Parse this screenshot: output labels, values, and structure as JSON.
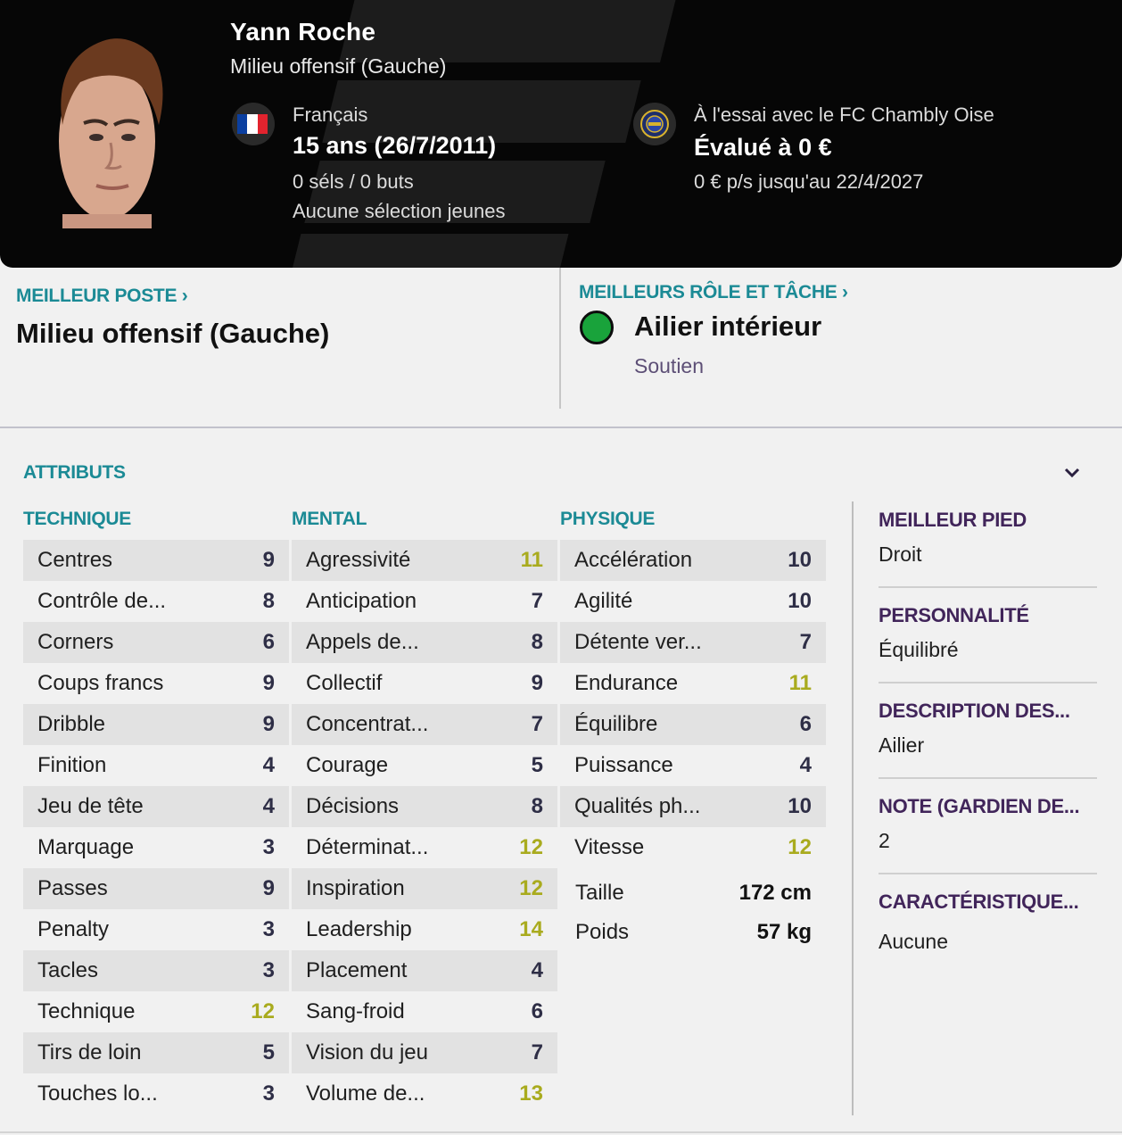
{
  "header": {
    "player_name": "Yann Roche",
    "position": "Milieu offensif (Gauche)",
    "nationality": "Français",
    "age_line": "15 ans (26/7/2011)",
    "caps_goals": "0 séls / 0 buts",
    "youth_caps": "Aucune sélection jeunes",
    "club_status": "À l'essai avec le FC Chambly Oise",
    "valuation": "Évalué à 0 €",
    "contract": "0 € p/s jusqu'au 22/4/2027",
    "flag_colors": [
      "#0b3fa0",
      "#ffffff",
      "#e3232e"
    ],
    "icons": [
      "player-face",
      "france-flag-icon",
      "club-crest-icon"
    ]
  },
  "best_position": {
    "link_label": "MEILLEUR POSTE",
    "value": "Milieu offensif (Gauche)"
  },
  "best_role": {
    "link_label": "MEILLEURS RÔLE ET TÂCHE",
    "role": "Ailier intérieur",
    "duty": "Soutien",
    "indicator_color": "#19a33b"
  },
  "attributes": {
    "title": "ATTRIBUTS",
    "technique": {
      "heading": "TECHNIQUE",
      "rows": [
        {
          "label": "Centres",
          "value": "9"
        },
        {
          "label": "Contrôle de...",
          "value": "8"
        },
        {
          "label": "Corners",
          "value": "6"
        },
        {
          "label": "Coups francs",
          "value": "9"
        },
        {
          "label": "Dribble",
          "value": "9"
        },
        {
          "label": "Finition",
          "value": "4"
        },
        {
          "label": "Jeu de tête",
          "value": "4"
        },
        {
          "label": "Marquage",
          "value": "3"
        },
        {
          "label": "Passes",
          "value": "9"
        },
        {
          "label": "Penalty",
          "value": "3"
        },
        {
          "label": "Tacles",
          "value": "3"
        },
        {
          "label": "Technique",
          "value": "12"
        },
        {
          "label": "Tirs de loin",
          "value": "5"
        },
        {
          "label": "Touches lo...",
          "value": "3"
        }
      ]
    },
    "mental": {
      "heading": "MENTAL",
      "rows": [
        {
          "label": "Agressivité",
          "value": "11"
        },
        {
          "label": "Anticipation",
          "value": "7"
        },
        {
          "label": "Appels de...",
          "value": "8"
        },
        {
          "label": "Collectif",
          "value": "9"
        },
        {
          "label": "Concentrat...",
          "value": "7"
        },
        {
          "label": "Courage",
          "value": "5"
        },
        {
          "label": "Décisions",
          "value": "8"
        },
        {
          "label": "Déterminat...",
          "value": "12"
        },
        {
          "label": "Inspiration",
          "value": "12"
        },
        {
          "label": "Leadership",
          "value": "14"
        },
        {
          "label": "Placement",
          "value": "4"
        },
        {
          "label": "Sang-froid",
          "value": "6"
        },
        {
          "label": "Vision du jeu",
          "value": "7"
        },
        {
          "label": "Volume de...",
          "value": "13"
        }
      ]
    },
    "physique": {
      "heading": "PHYSIQUE",
      "rows": [
        {
          "label": "Accélération",
          "value": "10"
        },
        {
          "label": "Agilité",
          "value": "10"
        },
        {
          "label": "Détente ver...",
          "value": "7"
        },
        {
          "label": "Endurance",
          "value": "11"
        },
        {
          "label": "Équilibre",
          "value": "6"
        },
        {
          "label": "Puissance",
          "value": "4"
        },
        {
          "label": "Qualités ph...",
          "value": "10"
        },
        {
          "label": "Vitesse",
          "value": "12"
        }
      ],
      "height_label": "Taille",
      "height_value": "172 cm",
      "weight_label": "Poids",
      "weight_value": "57 kg"
    },
    "value_colors": {
      "normal": "#2e2e46",
      "good": "#a9ab1e"
    }
  },
  "side_panel": {
    "items": [
      {
        "label": "MEILLEUR PIED",
        "value": "Droit"
      },
      {
        "label": "PERSONNALITÉ",
        "value": "Équilibré"
      },
      {
        "label": "DESCRIPTION DES...",
        "value": "Ailier"
      },
      {
        "label": "NOTE (GARDIEN DE...",
        "value": "2"
      },
      {
        "label": "CARACTÉRISTIQUE...",
        "value": "Aucune"
      }
    ]
  }
}
